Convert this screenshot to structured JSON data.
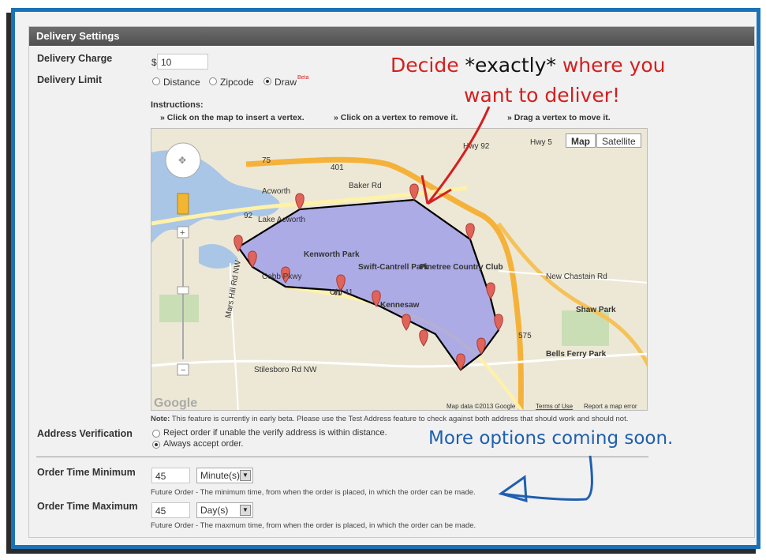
{
  "panel": {
    "title": "Delivery Settings"
  },
  "delivery_charge": {
    "label": "Delivery Charge",
    "currency": "$",
    "value": "10"
  },
  "delivery_limit": {
    "label": "Delivery Limit",
    "options": [
      "Distance",
      "Zipcode",
      "Draw"
    ],
    "selected": "Draw",
    "beta": "Beta"
  },
  "instructions": {
    "heading": "Instructions:",
    "items": [
      "» Click on the map to insert a vertex.",
      "» Click on a vertex to remove it.",
      "» Drag a vertex to move it."
    ]
  },
  "map": {
    "type_buttons": [
      "Map",
      "Satellite"
    ],
    "labels": [
      "Acworth",
      "Lake Acworth",
      "Kenworth Park",
      "Swift-Cantrell Park",
      "Pinetree Country Club",
      "Kennesaw",
      "Shaw Park",
      "Bells Ferry Park",
      "New Chastain Rd",
      "Mars Hill Rd NW",
      "Stilesboro Rd NW",
      "Old 41",
      "Cobb Pkwy",
      "Hwy 92",
      "Baker Rd",
      "Hwy 5",
      "401",
      "75",
      "575",
      "92",
      "41"
    ],
    "attribution": "Map data ©2013 Google",
    "terms": "Terms of Use",
    "report": "Report a map error",
    "logo": "Google"
  },
  "note": {
    "bold": "Note:",
    "text": "This feature is currently in early beta. Please use the Test Address feature to check against both address that should work and should not."
  },
  "address_verification": {
    "label": "Address Verification",
    "options": [
      "Reject order if unable the verify address is within distance.",
      "Always accept order."
    ],
    "selected": "Always accept order."
  },
  "order_min": {
    "label": "Order Time Minimum",
    "value": "45",
    "unit": "Minute(s)",
    "help": "Future Order - The minimum time, from when the order is placed, in which the order can be made."
  },
  "order_max": {
    "label": "Order Time Maximum",
    "value": "45",
    "unit": "Day(s)",
    "help": "Future Order - The maxmum time, from when the order is placed, in which the order can be made."
  },
  "annotations": {
    "top_pre": "Decide ",
    "top_emph": "*exactly*",
    "top_post": " where you",
    "top_line2": "want to deliver!",
    "bottom": "More options coming soon."
  },
  "colors": {
    "annotation_red": "#d42020",
    "annotation_blue": "#1f5fb0",
    "polygon_fill": "#8c8cf0",
    "frame_blue": "#1a73b8"
  }
}
